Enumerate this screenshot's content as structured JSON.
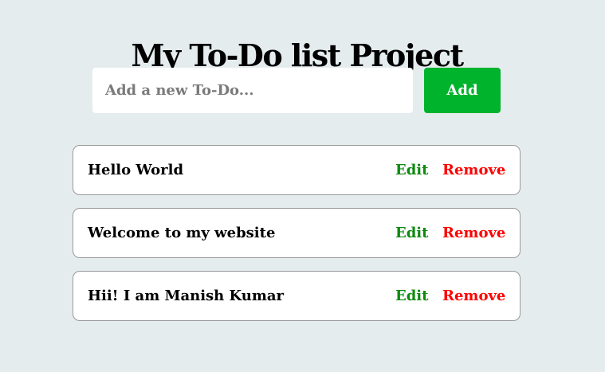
{
  "header": {
    "title": "My To-Do list Project"
  },
  "add_form": {
    "placeholder": "Add a new To-Do...",
    "value": "",
    "button_label": "Add"
  },
  "todos": [
    {
      "text": "Hello World",
      "edit_label": "Edit",
      "remove_label": "Remove"
    },
    {
      "text": "Welcome to my website",
      "edit_label": "Edit",
      "remove_label": "Remove"
    },
    {
      "text": "Hii! I am Manish Kumar",
      "edit_label": "Edit",
      "remove_label": "Remove"
    }
  ],
  "colors": {
    "background": "#e5ecee",
    "add_button": "#00b32d",
    "edit": "#0f8a10",
    "remove": "#ff0000"
  }
}
